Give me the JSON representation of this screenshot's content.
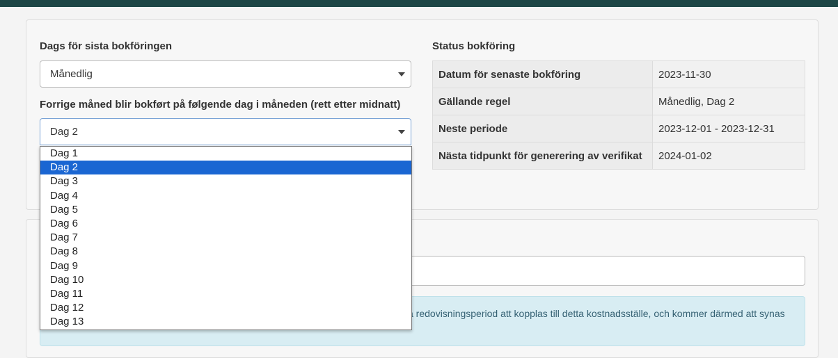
{
  "settings": {
    "freq_label": "Dags för sista bokföringen",
    "freq_value": "Månedlig",
    "day_label": "Forrige måned blir bokført på følgende dag i måneden (rett etter midnatt)",
    "day_value": "Dag 2"
  },
  "status": {
    "title": "Status bokföring",
    "rows": [
      {
        "key": "Datum för senaste bokföring",
        "value": "2023-11-30"
      },
      {
        "key": "Gällande regel",
        "value": "Månedlig, Dag 2"
      },
      {
        "key": "Neste periode",
        "value": "2023-12-01 - 2023-12-31"
      },
      {
        "key": "Nästa tidpunkt för generering av verifikat",
        "value": "2024-01-02"
      }
    ]
  },
  "dropdown": {
    "options": [
      "Dag 1",
      "Dag 2",
      "Dag 3",
      "Dag 4",
      "Dag 5",
      "Dag 6",
      "Dag 7",
      "Dag 8",
      "Dag 9",
      "Dag 10",
      "Dag 11",
      "Dag 12",
      "Dag 13"
    ],
    "selected_index": 1
  },
  "info": {
    "text": "a redovisningsperiod att kopplas till detta kostnadsställe, och kommer därmed att synas"
  },
  "colors": {
    "topbar": "#1d4646",
    "selected_option": "#1a66d2",
    "info_bg": "#d8edf3"
  }
}
